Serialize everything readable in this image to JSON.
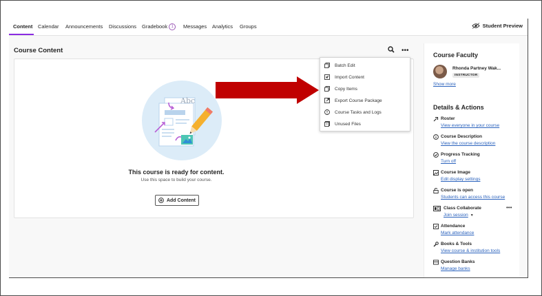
{
  "tabs": [
    {
      "label": "Content",
      "active": true
    },
    {
      "label": "Calendar"
    },
    {
      "label": "Announcements"
    },
    {
      "label": "Discussions"
    },
    {
      "label": "Gradebook",
      "badge": "1"
    },
    {
      "label": "Messages"
    },
    {
      "label": "Analytics"
    },
    {
      "label": "Groups"
    }
  ],
  "student_preview": "Student Preview",
  "course_content": {
    "title": "Course Content",
    "ready_title": "This course is ready for content.",
    "ready_sub": "Use this space to build your course.",
    "add_content": "Add Content",
    "illustration_text": "Abc"
  },
  "menu": {
    "items": [
      {
        "label": "Batch Edit",
        "icon": "batch-edit-icon"
      },
      {
        "label": "Import Content",
        "icon": "import-icon"
      },
      {
        "label": "Copy Items",
        "icon": "copy-icon"
      },
      {
        "label": "Export Course Package",
        "icon": "export-icon"
      },
      {
        "label": "Course Tasks and Logs",
        "icon": "info-icon"
      },
      {
        "label": "Unused Files",
        "icon": "files-icon"
      }
    ]
  },
  "sidebar": {
    "faculty_heading": "Course Faculty",
    "faculty_name": "Rhonda Partney Wak...",
    "faculty_role": "INSTRUCTOR",
    "show_more": "Show more",
    "details_heading": "Details & Actions",
    "items": [
      {
        "title": "Roster",
        "link": "View everyone in your course",
        "icon": "roster-icon"
      },
      {
        "title": "Course Description",
        "link": "View the course description",
        "icon": "info-icon"
      },
      {
        "title": "Progress Tracking",
        "link": "Turn off",
        "icon": "check-icon"
      },
      {
        "title": "Course Image",
        "link": "Edit display settings",
        "icon": "image-icon"
      },
      {
        "title": "Course is open",
        "link": "Students can access this course",
        "icon": "lock-open-icon"
      },
      {
        "title": "Class Collaborate",
        "link": "Join session",
        "icon": "collaborate-icon"
      },
      {
        "title": "Attendance",
        "link": "Mark attendance",
        "icon": "attendance-icon"
      },
      {
        "title": "Books & Tools",
        "link": "View course & institution tools",
        "icon": "tools-icon"
      },
      {
        "title": "Question Banks",
        "link": "Manage banks",
        "icon": "banks-icon"
      }
    ]
  },
  "colors": {
    "accent": "#8a2be2",
    "link": "#2a62bd",
    "arrow": "#c00000"
  }
}
